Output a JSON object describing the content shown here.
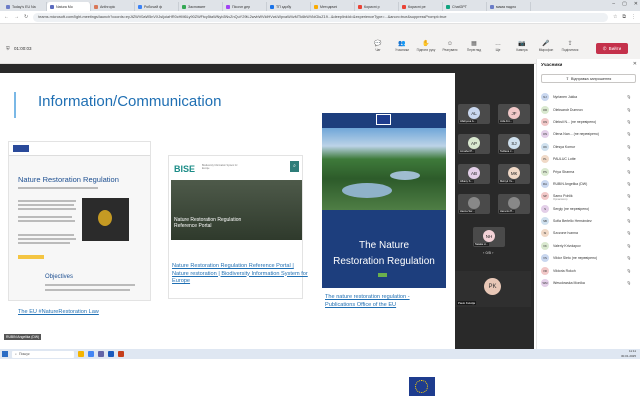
{
  "browser": {
    "tabs": [
      {
        "label": "Today's EU Na",
        "color": "#6b7cc7"
      },
      {
        "label": "Natura Mo",
        "color": "#5b6bbf",
        "active": true
      },
      {
        "label": "Anthropic",
        "color": "#d97757"
      },
      {
        "label": "Робочий ф",
        "color": "#3b82f6"
      },
      {
        "label": "Засновант",
        "color": "#34a853"
      },
      {
        "label": "Пісочн дер",
        "color": "#a142f4"
      },
      {
        "label": "ТП здобу",
        "color": "#1a73e8"
      },
      {
        "label": "Методичні",
        "color": "#f9ab00"
      },
      {
        "label": "Корисні р",
        "color": "#ea4335"
      },
      {
        "label": "Корисні ре",
        "color": "#ea4335"
      },
      {
        "label": "ChatGPT",
        "color": "#10a37f"
      },
      {
        "label": "мама надло",
        "color": "#6b7cc7"
      }
    ],
    "url": "teams.microsoft.com/light-meetings/launch?coords=eyJtZWV0aW5nVXJsIjoiaHR0cHM6Ly90ZWFtcy5taWNyb3NvZnQuY29tL2wvbWVldHVwLWpvaW4vMTk6bWVldGluZ19...&deeplinkId=&experienceType=...&anon=true&suppressPrompt=true"
  },
  "meeting": {
    "timer": "01:00:03",
    "toolbar": [
      {
        "label": "Чат",
        "icon": "chat-icon"
      },
      {
        "label": "Учасники",
        "icon": "people-icon"
      },
      {
        "label": "Підняти руку",
        "icon": "raise-hand-icon"
      },
      {
        "label": "Реагувати",
        "icon": "react-icon"
      },
      {
        "label": "Перегляд",
        "icon": "view-icon"
      },
      {
        "label": "Ще",
        "icon": "more-icon"
      },
      {
        "label": "Камера",
        "icon": "camera-icon"
      },
      {
        "label": "Мікрофон",
        "icon": "mic-icon"
      },
      {
        "label": "Поділитися",
        "icon": "share-icon"
      }
    ],
    "participants_count": "52",
    "leave_label": "Вийти"
  },
  "slide": {
    "title": "Information/Communication",
    "card1_heading": "Nature Restoration Regulation",
    "card1_objectives": "Objectives",
    "card1_link": "The EU #NatureRestoration Law",
    "card2_brand": "BISE",
    "card2_brand_sub": "Biodiversity Information System for Europe",
    "card2_hero": "Nature Restoration Regulation Reference Portal",
    "card2_link": "Nature Restoration Regulation Reference Portal | Nature restoration | Biodiversity Information System for Europe",
    "card3_line1": "The Nature",
    "card3_line2": "Restoration Regulation",
    "card3_link": "The nature restoration regulation - Publications Office of the EU"
  },
  "video_tiles": [
    {
      "initials": "AL",
      "name": "Allabyeva A...",
      "color": "#c9d7ef"
    },
    {
      "initials": "JF",
      "name": "Julia Fro...",
      "color": "#f1c8c8"
    },
    {
      "initials": "AP",
      "name": "Annabel P...",
      "color": "#d9e8cf"
    },
    {
      "initials": "SJ",
      "name": "Svitlana J...",
      "color": "#cfe0ee"
    },
    {
      "initials": "AB",
      "name": "Albany S...",
      "color": "#e3cfe8"
    },
    {
      "initials": "МК",
      "name": "Melnyk Ya...",
      "color": "#f0d9c7"
    },
    {
      "initials": "",
      "name": "Hanna Ser...",
      "color": "#888888"
    },
    {
      "initials": "",
      "name": "Наталія П...",
      "color": "#888888"
    },
    {
      "initials": "NH",
      "name": "Natalia H...",
      "color": "#f4d3d8"
    }
  ],
  "tiles_pager": "0/5",
  "self_tile": {
    "initials": "PK",
    "name": "Paulo Kukolja"
  },
  "presenter_label": "RUBIN Angelika (DW)",
  "panel": {
    "title": "Учасники",
    "share_invite": "Відправка запрошення",
    "people": [
      {
        "initials": "NJ",
        "name": "Nyrianen Jukka",
        "color": "#c9d7ef"
      },
      {
        "initials": "OD",
        "name": "Oleksandr Dumnov",
        "color": "#d9e8cf"
      },
      {
        "initials": "ON",
        "name": "Oleksii N... (не перевірено)",
        "color": "#f1c8c8"
      },
      {
        "initials": "ON",
        "name": "Olena Nan... (не перевірено)",
        "color": "#e3cfe8"
      },
      {
        "initials": "OK",
        "name": "Olesya Komur",
        "color": "#cfe0ee"
      },
      {
        "initials": "PL",
        "name": "PAULUC Lotte",
        "color": "#f0d9c7"
      },
      {
        "initials": "PS",
        "name": "Priya Sharma",
        "color": "#d9e8cf"
      },
      {
        "initials": "RA",
        "name": "RUBIN Angelika (DW)",
        "color": "#c9d7ef"
      },
      {
        "initials": "SP",
        "name": "Samo Pohlik",
        "sub": "Організатор",
        "color": "#f1c8c8"
      },
      {
        "initials": "S",
        "name": "Sergiy (не перевірено)",
        "color": "#e3cfe8"
      },
      {
        "initials": "SB",
        "name": "Sofia Berlello Hernández",
        "color": "#cfe0ee"
      },
      {
        "initials": "SI",
        "name": "Szczone Ivanna",
        "color": "#f0d9c7"
      },
      {
        "initials": "VK",
        "name": "Valeriy Krivolapov",
        "color": "#d9e8cf"
      },
      {
        "initials": "VS",
        "name": "Viktor Sleto (не перевірено)",
        "color": "#c9d7ef"
      },
      {
        "initials": "VR",
        "name": "Viktoria Rokoh",
        "color": "#f1c8c8"
      },
      {
        "initials": "WM",
        "name": "Wesolowska Monika",
        "color": "#e3cfe8"
      }
    ]
  },
  "taskbar": {
    "search_placeholder": "Пошук",
    "time": "11:11",
    "date": "30.01.2025"
  },
  "colors": {
    "accent": "#1f6fb3",
    "leave": "#c4314b"
  }
}
